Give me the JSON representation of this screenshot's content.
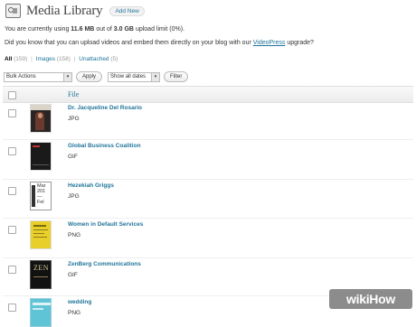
{
  "header": {
    "title": "Media Library",
    "add_new": "Add New"
  },
  "usage": {
    "prefix": "You are currently using",
    "used": "11.6 MB",
    "mid": "out of",
    "limit": "3.0 GB",
    "suffix": "upload limit (0%)."
  },
  "upsell": {
    "text": "Did you know that you can upload videos and embed them directly on your blog with our",
    "link": "VideoPress",
    "after": "upgrade?"
  },
  "filters": {
    "all_label": "All",
    "all_count": "(159)",
    "images_label": "Images",
    "images_count": "(158)",
    "unattached_label": "Unattached",
    "unattached_count": "(5)",
    "separator": "|"
  },
  "toolbar": {
    "bulk_actions": "Bulk Actions",
    "apply": "Apply",
    "dates": "Show all dates",
    "filter": "Filter",
    "arrow_icon": "chevron-down-icon"
  },
  "table": {
    "column_file": "File",
    "rows": [
      {
        "title": "Dr. Jacqueline Del Rosario",
        "type": "JPG"
      },
      {
        "title": "Global Business Coalition",
        "type": "GIF"
      },
      {
        "title": "Hezekiah Griggs",
        "type": "JPG",
        "thumb_text": [
          "Mar",
          "201",
          "—",
          "Fel"
        ]
      },
      {
        "title": "Women in Default Services",
        "type": "PNG"
      },
      {
        "title": "ZenBerg Communications",
        "type": "GIF",
        "thumb_text": [
          "ZEN"
        ]
      },
      {
        "title": "wedding",
        "type": "PNG"
      }
    ]
  },
  "watermark": {
    "brand": "wikiHow"
  },
  "colors": {
    "link": "#21759b",
    "text": "#333333",
    "header_bg": "#ececec",
    "watermark_bg": "#8c8c8c"
  }
}
